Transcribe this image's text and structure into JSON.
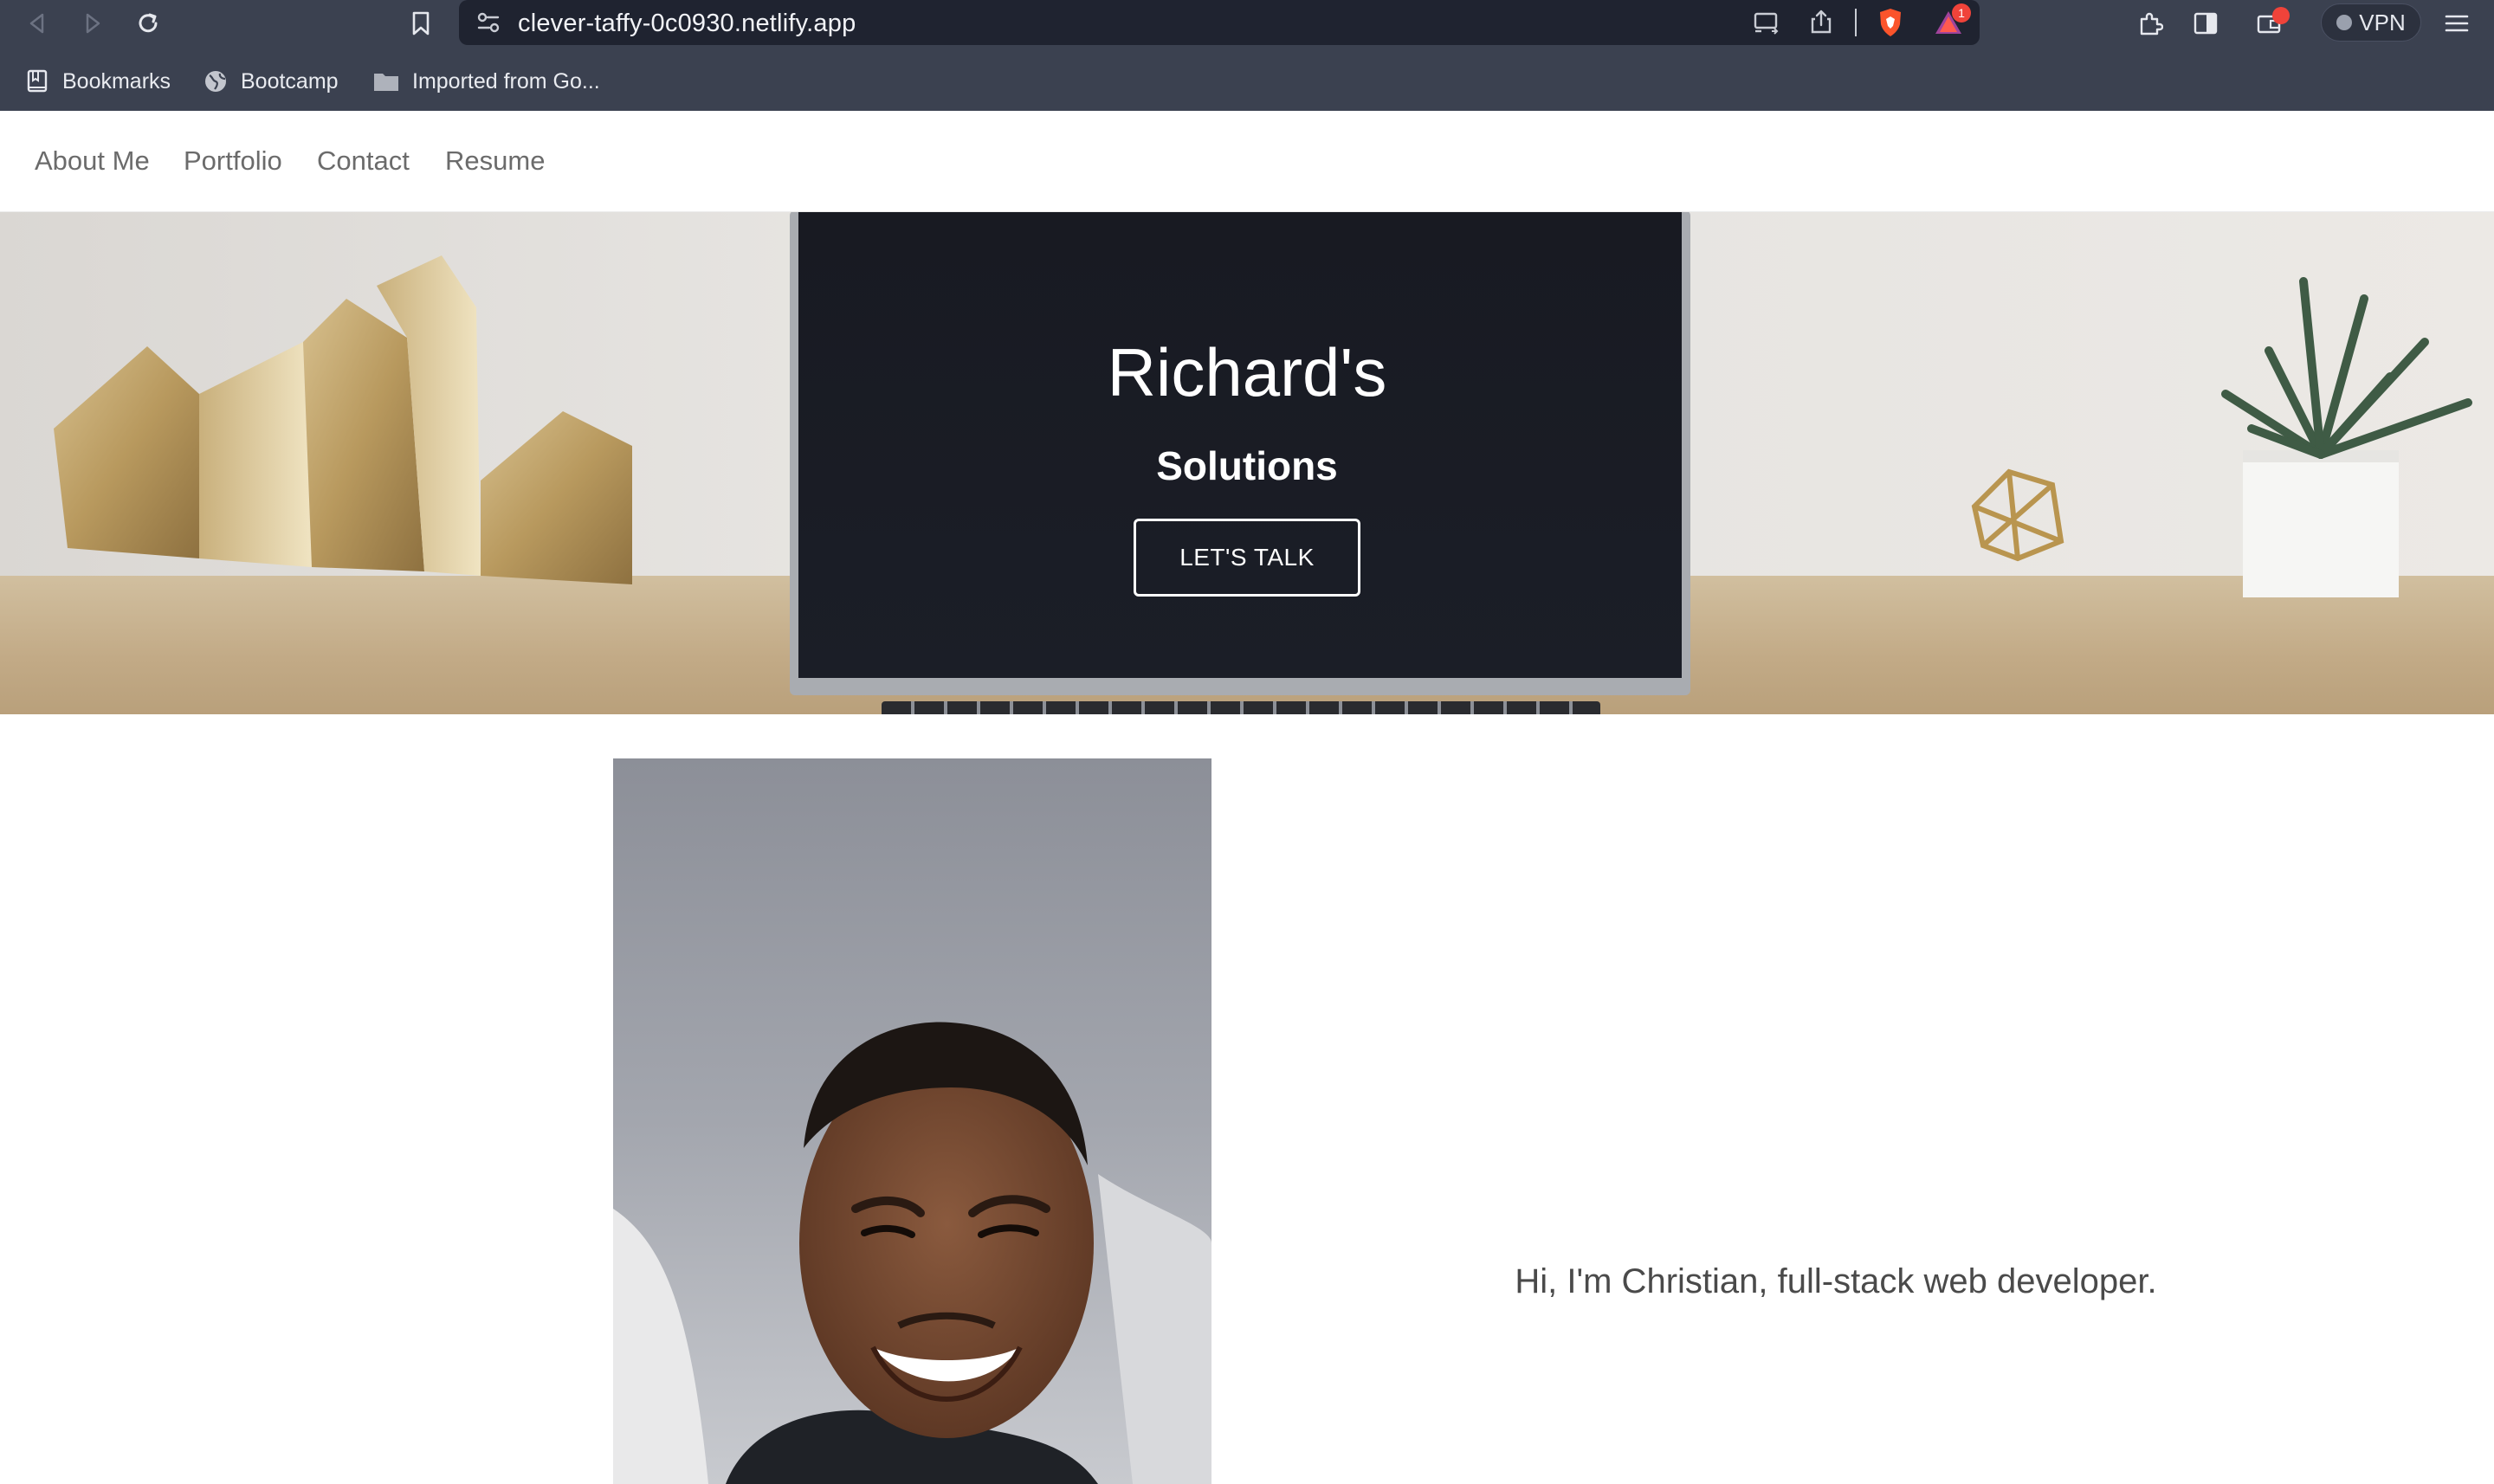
{
  "browser": {
    "url": "clever-taffy-0c0930.netlify.app",
    "vpn_label": "VPN",
    "rewards_badge": "1",
    "icons": [
      "back-icon",
      "forward-icon",
      "reload-icon",
      "bookmark-icon",
      "site-settings-icon",
      "cast-icon",
      "share-icon",
      "brave-shields-icon",
      "brave-rewards-icon",
      "extensions-icon",
      "sidebar-icon",
      "wallet-icon",
      "menu-icon"
    ]
  },
  "bookmarks": {
    "items": [
      {
        "label": "Bookmarks",
        "icon": "bookmarks-book-icon"
      },
      {
        "label": "Bootcamp",
        "icon": "globe-icon"
      },
      {
        "label": "Imported from Go...",
        "icon": "folder-icon"
      }
    ]
  },
  "nav": {
    "links": [
      "About Me",
      "Portfolio",
      "Contact",
      "Resume"
    ]
  },
  "hero": {
    "title": "Richard's",
    "subtitle": "Solutions",
    "cta": "LET'S TALK"
  },
  "about": {
    "intro": "Hi, I'm Christian, full-stack web developer."
  },
  "colors": {
    "chrome": "#3b4150",
    "urlbar": "#1f2330",
    "nav_text": "#6b6b6b",
    "hero_text": "#ffffff",
    "body_text": "#4a4a4a"
  }
}
